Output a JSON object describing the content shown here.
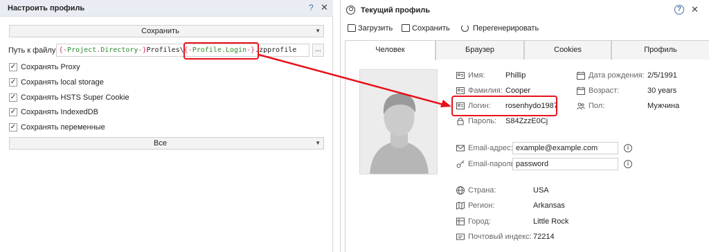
{
  "left_panel": {
    "title": "Настроить профиль",
    "help_label": "?",
    "close_label": "✕",
    "save_dropdown": "Сохранить",
    "path_label": "Путь к файлу",
    "path_segments": [
      {
        "text": "{-",
        "kind": "brace"
      },
      {
        "text": "Project",
        "kind": "var"
      },
      {
        "text": ".",
        "kind": "dot"
      },
      {
        "text": "Directory",
        "kind": "var"
      },
      {
        "text": "-}",
        "kind": "brace"
      },
      {
        "text": "Profiles\\",
        "kind": "plain"
      },
      {
        "text": "{-",
        "kind": "brace"
      },
      {
        "text": "Profile",
        "kind": "var"
      },
      {
        "text": ".",
        "kind": "dot"
      },
      {
        "text": "Login",
        "kind": "var"
      },
      {
        "text": "-}",
        "kind": "brace"
      },
      {
        "text": ".zpprofile",
        "kind": "plain"
      }
    ],
    "browse_label": "...",
    "checkboxes": [
      {
        "label": "Сохранять Proxy",
        "checked": true
      },
      {
        "label": "Сохранять local storage",
        "checked": true
      },
      {
        "label": "Сохранять HSTS Super Cookie",
        "checked": true
      },
      {
        "label": "Сохранять IndexedDB",
        "checked": true
      },
      {
        "label": "Сохранять переменные",
        "checked": true
      }
    ],
    "all_dropdown": "Все"
  },
  "right_panel": {
    "title": "Текущий профиль",
    "help_label": "?",
    "close_label": "✕",
    "toolbar": {
      "load": "Загрузить",
      "save": "Сохранить",
      "regenerate": "Перегенерировать"
    },
    "tabs": [
      "Человек",
      "Браузер",
      "Cookies",
      "Профиль"
    ],
    "active_tab": 0,
    "person": {
      "name_label": "Имя:",
      "name": "Phillip",
      "surname_label": "Фамилия:",
      "surname": "Cooper",
      "login_label": "Логин:",
      "login": "rosenhydo1987",
      "password_label": "Пароль:",
      "password": "S84ZzzE0Cj",
      "birth_label": "Дата рождения:",
      "birth": "2/5/1991",
      "age_label": "Возраст:",
      "age": "30 years",
      "sex_label": "Пол:",
      "sex": "Мужчина",
      "email_label": "Email-адрес:",
      "email": "example@example.com",
      "email_password_label": "Email-пароль:",
      "email_password": "password",
      "country_label": "Страна:",
      "country": "USA",
      "region_label": "Регион:",
      "region": "Arkansas",
      "city_label": "Город:",
      "city": "Little Rock",
      "zip_label": "Почтовый индекс:",
      "zip": "72214"
    }
  },
  "colors": {
    "highlight": "#e8111a",
    "header_bg": "#e9edf3",
    "accent": "#4a6fa5",
    "brace": "#d4306c",
    "variable": "#2e8b2e"
  }
}
